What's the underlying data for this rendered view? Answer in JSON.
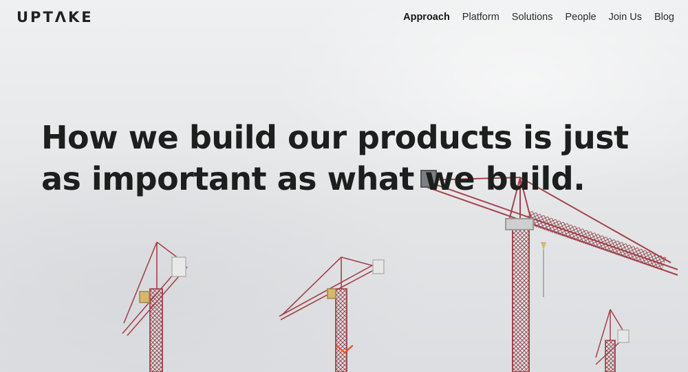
{
  "header": {
    "logo": "UPTΛKE",
    "nav": [
      {
        "label": "Approach",
        "active": true
      },
      {
        "label": "Platform",
        "active": false
      },
      {
        "label": "Solutions",
        "active": false
      },
      {
        "label": "People",
        "active": false
      },
      {
        "label": "Join Us",
        "active": false
      },
      {
        "label": "Blog",
        "active": false
      }
    ]
  },
  "hero": {
    "headline": "How we build our products is just as important as what we build.",
    "background_image": "construction-cranes-photo",
    "scroll_icon": "chevron-down-icon"
  },
  "colors": {
    "text": "#1c1f1d",
    "accent": "#e8531f",
    "crane_red": "#a8414a",
    "sky": "#e6e7e9"
  }
}
